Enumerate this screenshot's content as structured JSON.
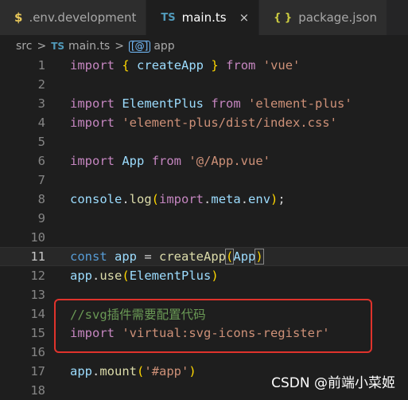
{
  "tabs": [
    {
      "icon": "$",
      "label": ".env.development",
      "active": false
    },
    {
      "icon": "TS",
      "label": "main.ts",
      "active": true,
      "close": "×"
    },
    {
      "icon": "{ }",
      "label": "package.json",
      "active": false
    }
  ],
  "breadcrumb": {
    "folder": "src",
    "file_icon": "TS",
    "file": "main.ts",
    "symbol_icon": "[@]",
    "symbol": "app",
    "separator": ">"
  },
  "editor": {
    "current_line": "11",
    "lines": [
      {
        "n": "1",
        "tokens": [
          [
            "kw",
            "import"
          ],
          [
            "pl",
            " "
          ],
          [
            "br1",
            "{"
          ],
          [
            "pl",
            " "
          ],
          [
            "var",
            "createApp"
          ],
          [
            "pl",
            " "
          ],
          [
            "br1",
            "}"
          ],
          [
            "pl",
            " "
          ],
          [
            "kw",
            "from"
          ],
          [
            "pl",
            " "
          ],
          [
            "str",
            "'vue'"
          ]
        ]
      },
      {
        "n": "2",
        "tokens": []
      },
      {
        "n": "3",
        "tokens": [
          [
            "kw",
            "import"
          ],
          [
            "pl",
            " "
          ],
          [
            "var",
            "ElementPlus"
          ],
          [
            "pl",
            " "
          ],
          [
            "kw",
            "from"
          ],
          [
            "pl",
            " "
          ],
          [
            "str",
            "'element-plus'"
          ]
        ]
      },
      {
        "n": "4",
        "tokens": [
          [
            "kw",
            "import"
          ],
          [
            "pl",
            " "
          ],
          [
            "str",
            "'element-plus/dist/index.css'"
          ]
        ]
      },
      {
        "n": "5",
        "tokens": []
      },
      {
        "n": "6",
        "tokens": [
          [
            "kw",
            "import"
          ],
          [
            "pl",
            " "
          ],
          [
            "var",
            "App"
          ],
          [
            "pl",
            " "
          ],
          [
            "kw",
            "from"
          ],
          [
            "pl",
            " "
          ],
          [
            "str",
            "'@/App.vue'"
          ]
        ]
      },
      {
        "n": "7",
        "tokens": []
      },
      {
        "n": "8",
        "tokens": [
          [
            "var",
            "console"
          ],
          [
            "pl",
            "."
          ],
          [
            "fn",
            "log"
          ],
          [
            "br1",
            "("
          ],
          [
            "kw",
            "import"
          ],
          [
            "pl",
            "."
          ],
          [
            "var",
            "meta"
          ],
          [
            "pl",
            "."
          ],
          [
            "var",
            "env"
          ],
          [
            "br1",
            ")"
          ],
          [
            "pl",
            ";"
          ]
        ]
      },
      {
        "n": "9",
        "tokens": []
      },
      {
        "n": "10",
        "tokens": []
      },
      {
        "n": "11",
        "tokens": [
          [
            "kw2",
            "const"
          ],
          [
            "pl",
            " "
          ],
          [
            "var",
            "app"
          ],
          [
            "pl",
            " = "
          ],
          [
            "fn",
            "createApp"
          ],
          [
            "br1",
            "("
          ],
          [
            "var",
            "App"
          ],
          [
            "br1",
            ")"
          ]
        ]
      },
      {
        "n": "12",
        "tokens": [
          [
            "var",
            "app"
          ],
          [
            "pl",
            "."
          ],
          [
            "fn",
            "use"
          ],
          [
            "br1",
            "("
          ],
          [
            "var",
            "ElementPlus"
          ],
          [
            "br1",
            ")"
          ]
        ]
      },
      {
        "n": "13",
        "tokens": []
      },
      {
        "n": "14",
        "tokens": [
          [
            "cmt",
            "//svg插件需要配置代码"
          ]
        ]
      },
      {
        "n": "15",
        "tokens": [
          [
            "kw",
            "import"
          ],
          [
            "pl",
            " "
          ],
          [
            "str",
            "'virtual:svg-icons-register'"
          ]
        ]
      },
      {
        "n": "16",
        "tokens": []
      },
      {
        "n": "17",
        "tokens": [
          [
            "var",
            "app"
          ],
          [
            "pl",
            "."
          ],
          [
            "fn",
            "mount"
          ],
          [
            "br1",
            "("
          ],
          [
            "str",
            "'#app'"
          ],
          [
            "br1",
            ")"
          ]
        ]
      },
      {
        "n": "18",
        "tokens": []
      }
    ]
  },
  "watermark": "CSDN @前端小菜姬",
  "colors": {
    "background": "#1e1e1e",
    "highlight_box": "#e0332c",
    "keyword": "#c586c0",
    "string": "#ce9178",
    "variable": "#9cdcfe",
    "comment": "#6a9955"
  }
}
